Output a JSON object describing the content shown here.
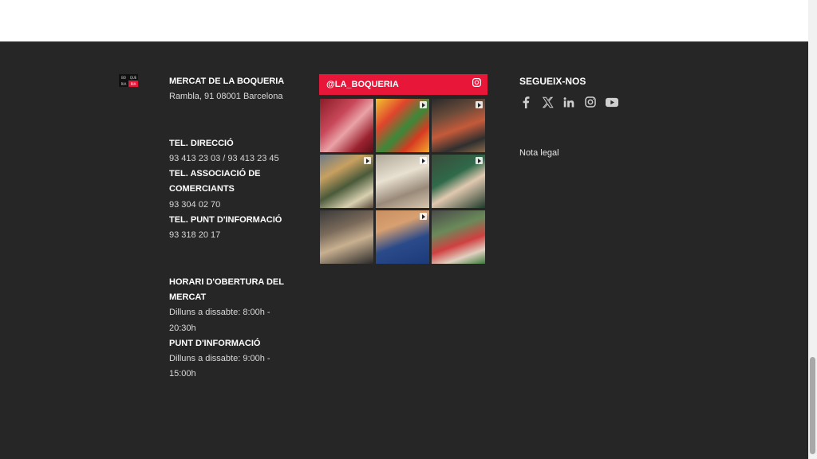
{
  "logo": {
    "cells": [
      "BO",
      "QUE",
      "RIA",
      "RIA"
    ]
  },
  "market": {
    "name": "MERCAT DE LA BOQUERIA",
    "address": "Rambla, 91 08001 Barcelona"
  },
  "phones": {
    "direccio_label": "TEL. DIRECCIÓ",
    "direccio_value": "93 413 23 03 / 93 413 23 45",
    "associacio_label": "TEL. ASSOCIACIÓ DE COMERCIANTS",
    "associacio_value": "93 304 02 70",
    "info_label": "TEL. PUNT D'INFORMACIÓ",
    "info_value": "93 318 20 17"
  },
  "hours": {
    "market_label": "HORARI D'OBERTURA DEL MERCAT",
    "market_value": "Dilluns a dissabte: 8:00h - 20:30h",
    "info_label": "PUNT D'INFORMACIÓ",
    "info_value": "Dilluns a dissabte: 9:00h - 15:00h"
  },
  "instagram": {
    "handle": "@LA_BOQUERIA",
    "icon": "instagram-icon",
    "tiles": [
      {
        "bg": "linear-gradient(135deg,#8b1c28 0%,#c8485a 35%,#e9a3a6 55%,#9c2230 80%,#5a1017 100%)"
      },
      {
        "bg": "linear-gradient(135deg,#f2c230 0%,#e0452c 30%,#3a8a3a 55%,#d63a22 75%,#f4a72a 100%)"
      },
      {
        "bg": "linear-gradient(160deg,#2a2a2a 0%,#6b4b3a 30%,#c45a3a 55%,#2f2f2f 80%,#8a6a4a 100%)"
      },
      {
        "bg": "linear-gradient(150deg,#6a7a8a 0%,#c8a060 30%,#4a5a3a 55%,#d8d0b0 80%,#5a4a3a 100%)"
      },
      {
        "bg": "linear-gradient(160deg,#b0a898 0%,#e8e0d0 40%,#9a8a7a 70%,#d8c8b0 100%)"
      },
      {
        "bg": "linear-gradient(150deg,#3a4a3a 0%,#2f6a4a 40%,#e0c8b0 60%,#1f3a2a 100%)"
      },
      {
        "bg": "linear-gradient(160deg,#3a3a3a 0%,#7a6a5a 35%,#c8b090 60%,#2a2a2a 100%)"
      },
      {
        "bg": "linear-gradient(160deg,#c89060 0%,#d8a070 30%,#2a4a8a 60%,#1a3a7a 100%)"
      },
      {
        "bg": "linear-gradient(160deg,#4a4a4a 0%,#6a8a5a 35%,#d04040 60%,#e0d0c0 80%,#3a7a3a 100%)"
      }
    ]
  },
  "follow": {
    "title": "SEGUEIX-NOS",
    "icons": [
      "facebook-icon",
      "x-icon",
      "linkedin-icon",
      "instagram-icon",
      "youtube-icon"
    ],
    "legal": "Nota legal"
  },
  "colors": {
    "footer_bg": "#262626",
    "accent": "#e8173a"
  }
}
